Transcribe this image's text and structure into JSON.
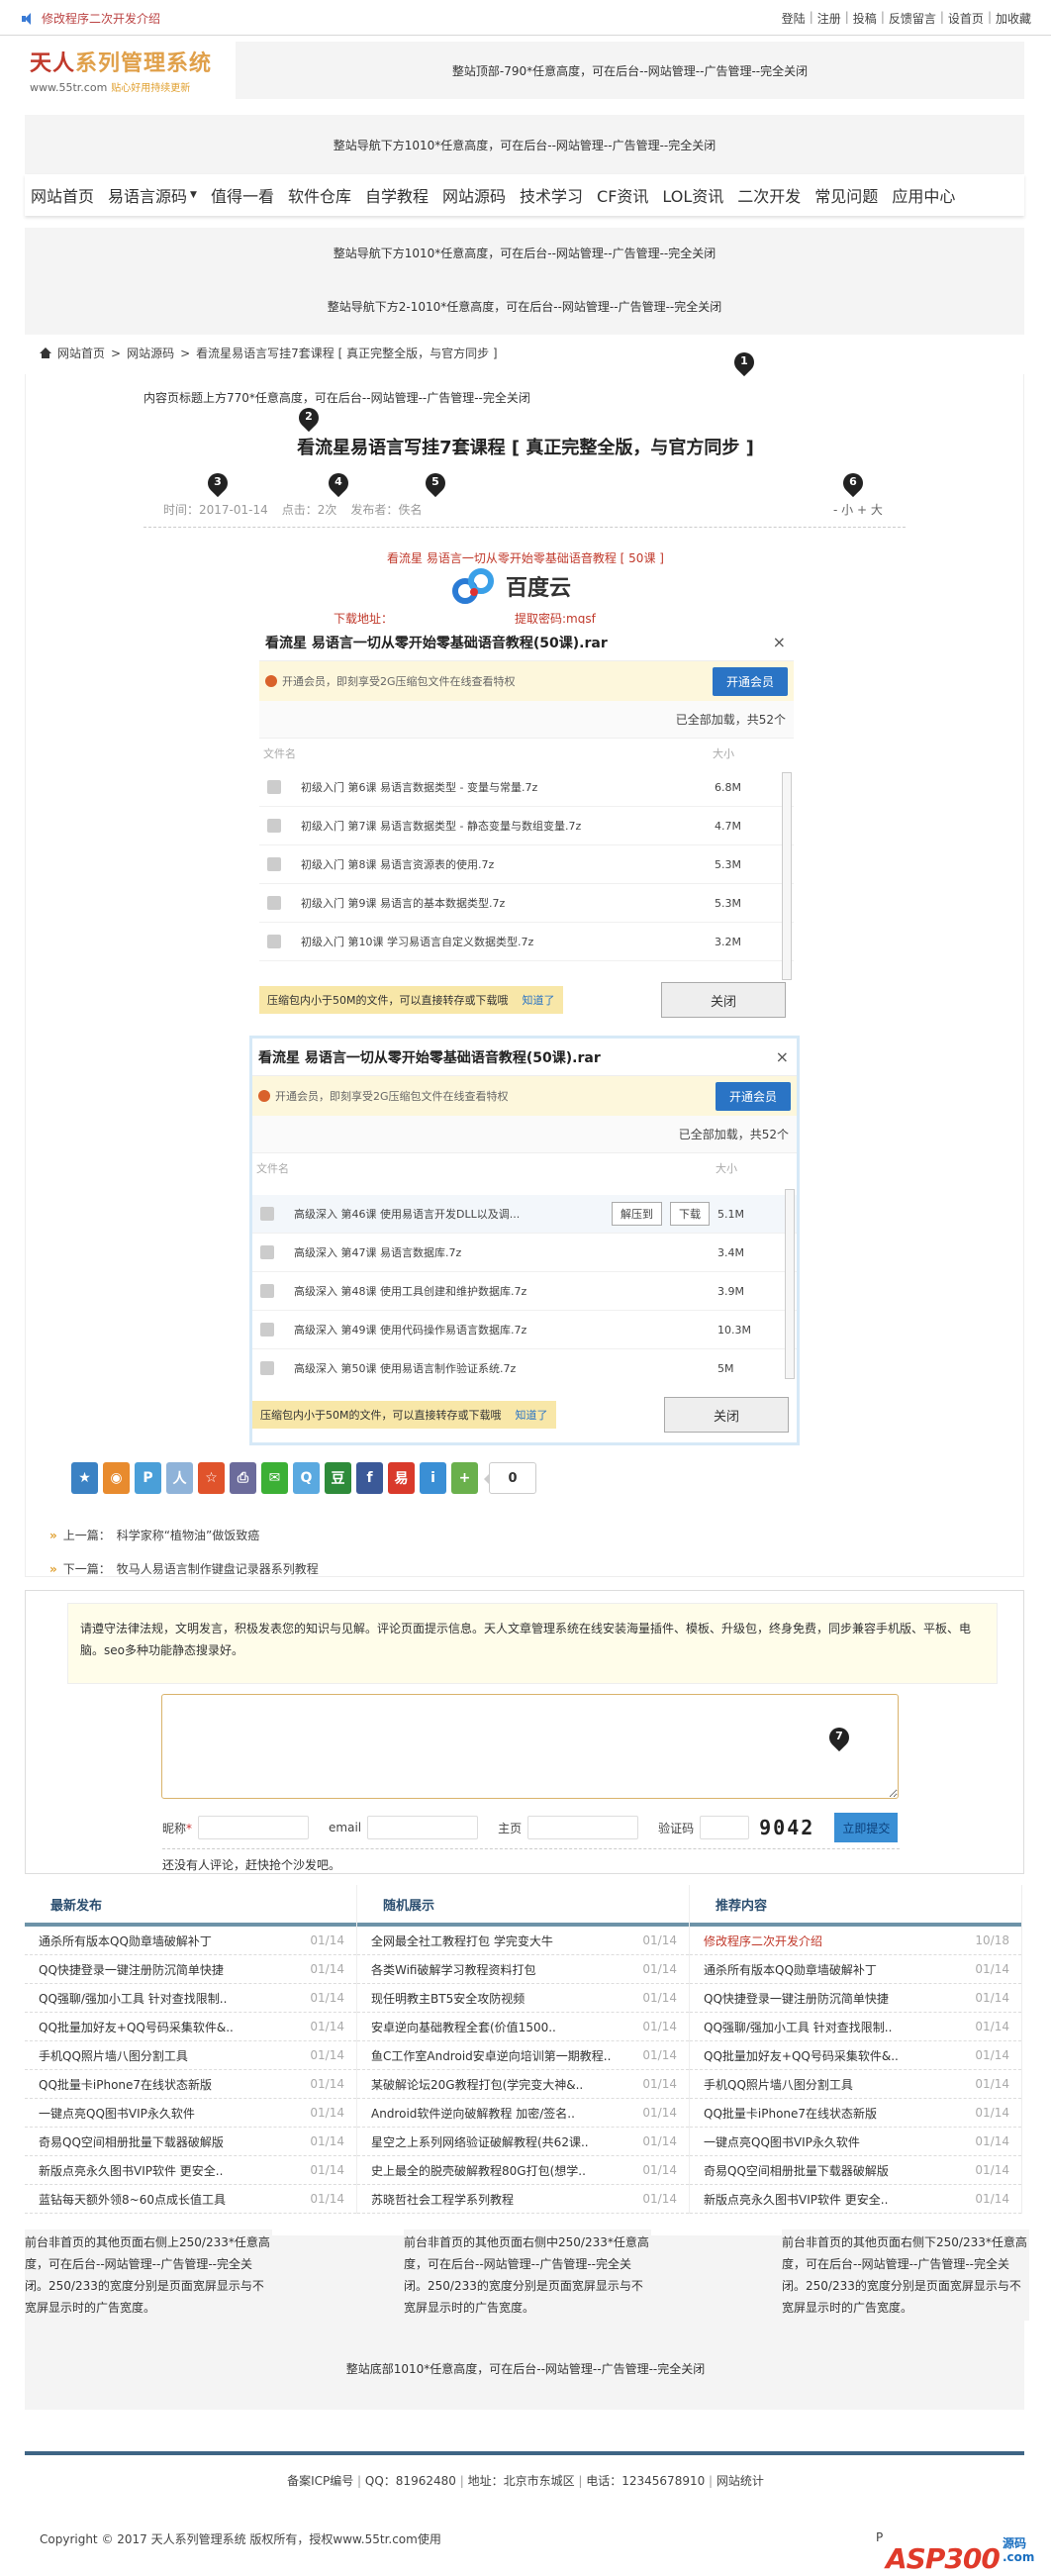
{
  "topbar": {
    "notice": "修改程序二次开发介绍",
    "links": [
      "登陆",
      "注册",
      "投稿",
      "反馈留言",
      "设首页",
      "加收藏"
    ]
  },
  "logo": {
    "name_part1": "天人",
    "name_part2": "系列管理系统",
    "url": "www.55tr.com",
    "slogan": "贴心好用持续更新"
  },
  "ads": {
    "top": "整站顶部-790*任意高度，可在后台--网站管理--广告管理--完全关闭",
    "nav_below_1": "整站导航下方1010*任意高度，可在后台--网站管理--广告管理--完全关闭",
    "nav_below_2": "整站导航下方1010*任意高度，可在后台--网站管理--广告管理--完全关闭",
    "nav_below_3": "整站导航下方2-1010*任意高度，可在后台--网站管理--广告管理--完全关闭",
    "above_title": "内容页标题上方770*任意高度，可在后台--网站管理--广告管理--完全关闭",
    "right_top": "前台非首页的其他页面右侧上250/233*任意高度，可在后台--网站管理--广告管理--完全关闭。250/233的宽度分别是页面宽屏显示与不宽屏显示时的广告宽度。",
    "right_mid": "前台非首页的其他页面右侧中250/233*任意高度，可在后台--网站管理--广告管理--完全关闭。250/233的宽度分别是页面宽屏显示与不宽屏显示时的广告宽度。",
    "right_bottom": "前台非首页的其他页面右侧下250/233*任意高度，可在后台--网站管理--广告管理--完全关闭。250/233的宽度分别是页面宽屏显示与不宽屏显示时的广告宽度。",
    "site_bottom": "整站底部1010*任意高度，可在后台--网站管理--广告管理--完全关闭"
  },
  "nav": {
    "items": [
      "网站首页",
      "易语言源码",
      "值得一看",
      "软件仓库",
      "自学教程",
      "网站源码",
      "技术学习",
      "CF资讯",
      "LOL资讯",
      "二次开发",
      "常见问题",
      "应用中心"
    ],
    "dropdown_index": 1
  },
  "breadcrumb": {
    "items": [
      "网站首页",
      "网站源码",
      "看流星易语言写挂7套课程 [ 真正完整全版，与官方同步 ]"
    ],
    "sep": ">"
  },
  "article": {
    "title": "看流星易语言写挂7套课程 [ 真正完整全版，与官方同步 ]",
    "time_label": "时间：",
    "time": "2017-01-14",
    "clicks_label": "点击：",
    "clicks": "2次",
    "author_label": "发布者：",
    "author": "佚名",
    "font_size_ctrl": "- 小 + 大",
    "markers": [
      "1",
      "2",
      "3",
      "4",
      "5",
      "6",
      "7"
    ],
    "download_title": "看流星 易语言一切从零开始零基础语音教程 [ 50课 ]",
    "download_label": "下载地址：",
    "baidu_name": "百度云",
    "password": "提取密码:mqsf"
  },
  "dialog1": {
    "title": "看流星 易语言一切从零开始零基础语音教程(50课).rar",
    "close": "×",
    "vip_msg": "开通会员，即刻享受2G压缩包文件在线查看特权",
    "vip_btn": "开通会员",
    "loaded": "已全部加载，共52个",
    "col_name": "文件名",
    "col_size": "大小",
    "files": [
      {
        "name": "初级入门 第6课 易语言数据类型 - 变量与常量.7z",
        "size": "6.8M"
      },
      {
        "name": "初级入门 第7课 易语言数据类型 - 静态变量与数组变量.7z",
        "size": "4.7M"
      },
      {
        "name": "初级入门 第8课 易语言资源表的使用.7z",
        "size": "5.3M"
      },
      {
        "name": "初级入门 第9课 易语言的基本数据类型.7z",
        "size": "5.3M"
      },
      {
        "name": "初级入门 第10课 学习易语言自定义数据类型.7z",
        "size": "3.2M"
      }
    ],
    "tip": "压缩包内小于50M的文件，可以直接转存或下载哦",
    "tip_ok": "知道了",
    "close_btn": "关闭"
  },
  "dialog2": {
    "title": "看流星 易语言一切从零开始零基础语音教程(50课).rar",
    "close": "×",
    "vip_msg": "开通会员，即刻享受2G压缩包文件在线查看特权",
    "vip_btn": "开通会员",
    "loaded": "已全部加载，共52个",
    "col_name": "文件名",
    "col_size": "大小",
    "files": [
      {
        "name": "高级深入 第46课 使用易语言开发DLL以及调...",
        "size": "5.1M"
      },
      {
        "name": "高级深入 第47课 易语言数据库.7z",
        "size": "3.4M"
      },
      {
        "name": "高级深入 第48课 使用工具创建和维护数据库.7z",
        "size": "3.9M"
      },
      {
        "name": "高级深入 第49课 使用代码操作易语言数据库.7z",
        "size": "10.3M"
      },
      {
        "name": "高级深入 第50课 使用易语言制作验证系统.7z",
        "size": "5M"
      }
    ],
    "row_btn_extract": "解压到",
    "row_btn_download": "下载",
    "tip": "压缩包内小于50M的文件，可以直接转存或下载哦",
    "tip_ok": "知道了",
    "close_btn": "关闭"
  },
  "share": {
    "icons": [
      {
        "name": "favorite",
        "glyph": "★",
        "color": "#3b82c4"
      },
      {
        "name": "weibo",
        "glyph": "◉",
        "color": "#e88b2e"
      },
      {
        "name": "pinterest",
        "glyph": "P",
        "color": "#4a9fd8"
      },
      {
        "name": "renren",
        "glyph": "人",
        "color": "#8fb3d9"
      },
      {
        "name": "kaixin",
        "glyph": "☆",
        "color": "#e0532b"
      },
      {
        "name": "print",
        "glyph": "⎙",
        "color": "#6b6b9b"
      },
      {
        "name": "wechat",
        "glyph": "✉",
        "color": "#3cb035"
      },
      {
        "name": "qq",
        "glyph": "Q",
        "color": "#5aa9e0"
      },
      {
        "name": "douban",
        "glyph": "豆",
        "color": "#2e8b3a"
      },
      {
        "name": "facebook",
        "glyph": "f",
        "color": "#3b5998"
      },
      {
        "name": "netease",
        "glyph": "易",
        "color": "#d93a2b"
      },
      {
        "name": "tieba",
        "glyph": "i",
        "color": "#3a8fd5"
      },
      {
        "name": "more",
        "glyph": "+",
        "color": "#6ab04c"
      }
    ],
    "count": "0"
  },
  "prevnext": {
    "prev_label": "上一篇：",
    "prev": "科学家称“植物油”做饭致癌",
    "next_label": "下一篇：",
    "next": "牧马人易语言制作键盘记录器系列教程"
  },
  "comments": {
    "notice": "请遵守法律法规，文明发言，积极发表您的知识与见解。评论页面提示信息。天人文章管理系统在线安装海量插件、模板、升级包，终身免费，同步兼容手机版、平板、电脑。seo多种功能静态搜录好。",
    "nick_label": "昵称",
    "required": "*",
    "email_label": "email",
    "home_label": "主页",
    "captcha_label": "验证码",
    "captcha": "9042",
    "submit": "立即提交",
    "empty": "还没有人评论，赶快抢个沙发吧。"
  },
  "lists": [
    {
      "title": "最新发布",
      "items": [
        {
          "t": "通杀所有版本QQ勋章墙破解补丁",
          "d": "01/14"
        },
        {
          "t": "QQ快捷登录一键注册防沉简单快捷",
          "d": "01/14"
        },
        {
          "t": "QQ强聊/强加小工具 针对查找限制..",
          "d": "01/14"
        },
        {
          "t": "QQ批量加好友+QQ号码采集软件&..",
          "d": "01/14"
        },
        {
          "t": "手机QQ照片墙八图分割工具",
          "d": "01/14"
        },
        {
          "t": "QQ批量卡iPhone7在线状态新版",
          "d": "01/14"
        },
        {
          "t": "一键点亮QQ图书VIP永久软件",
          "d": "01/14"
        },
        {
          "t": "奇易QQ空间相册批量下载器破解版",
          "d": "01/14"
        },
        {
          "t": "新版点亮永久图书VIP软件 更安全..",
          "d": "01/14"
        },
        {
          "t": "蓝钻每天额外领8~60点成长值工具",
          "d": "01/14"
        }
      ]
    },
    {
      "title": "随机展示",
      "items": [
        {
          "t": "全网最全社工教程打包 学完变大牛",
          "d": "01/14"
        },
        {
          "t": "各类Wifi破解学习教程资料打包",
          "d": "01/14"
        },
        {
          "t": "现任明教主BT5安全攻防视频",
          "d": "01/14"
        },
        {
          "t": "安卓逆向基础教程全套(价值1500..",
          "d": "01/14"
        },
        {
          "t": "鱼C工作室Android安卓逆向培训第一期教程..",
          "d": "01/14"
        },
        {
          "t": "某破解论坛20G教程打包(学完变大神&..",
          "d": "01/14"
        },
        {
          "t": "Android软件逆向破解教程 加密/签名..",
          "d": "01/14"
        },
        {
          "t": "星空之上系列网络验证破解教程(共62课..",
          "d": "01/14"
        },
        {
          "t": "史上最全的脱壳破解教程80G打包(想学..",
          "d": "01/14"
        },
        {
          "t": "苏晓哲社会工程学系列教程",
          "d": "01/14"
        }
      ]
    },
    {
      "title": "推荐内容",
      "items": [
        {
          "t": "修改程序二次开发介绍",
          "d": "10/18",
          "highlight": true
        },
        {
          "t": "通杀所有版本QQ勋章墙破解补丁",
          "d": "01/14"
        },
        {
          "t": "QQ快捷登录一键注册防沉简单快捷",
          "d": "01/14"
        },
        {
          "t": "QQ强聊/强加小工具 针对查找限制..",
          "d": "01/14"
        },
        {
          "t": "QQ批量加好友+QQ号码采集软件&..",
          "d": "01/14"
        },
        {
          "t": "手机QQ照片墙八图分割工具",
          "d": "01/14"
        },
        {
          "t": "QQ批量卡iPhone7在线状态新版",
          "d": "01/14"
        },
        {
          "t": "一键点亮QQ图书VIP永久软件",
          "d": "01/14"
        },
        {
          "t": "奇易QQ空间相册批量下载器破解版",
          "d": "01/14"
        },
        {
          "t": "新版点亮永久图书VIP软件 更安全..",
          "d": "01/14"
        }
      ]
    }
  ],
  "footer": {
    "links": [
      "备案ICP编号",
      "QQ：81962480",
      "地址：北京市东城区",
      "电话：12345678910",
      "网站统计"
    ],
    "copyright": "Copyright © 2017 天人系列管理系统 版权所有，授权www.55tr.com使用",
    "watermark_p": "P",
    "watermark": "ASP300",
    "watermark_sub1": "源码",
    "watermark_sub2": ".com"
  },
  "colors": {
    "accent_red": "#c0392b",
    "nav_blue": "#2a74c5",
    "footer_bar": "#3e6585",
    "list_header_bar": "#6d93a8"
  }
}
